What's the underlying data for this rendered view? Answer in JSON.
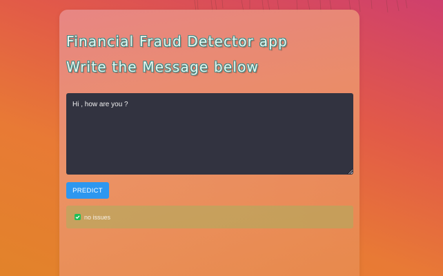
{
  "app": {
    "title": "Financial Fraud Detector app",
    "subtitle": "Write the Message below"
  },
  "message": {
    "value": "Hi , how are you ?",
    "placeholder": ""
  },
  "actions": {
    "predict_label": "PREDICT"
  },
  "result": {
    "text": "no issues",
    "icon": "check-icon",
    "color": "#1fbf56"
  },
  "colors": {
    "accent": "#2d97f0",
    "textarea_bg": "#323340",
    "title_outline": "#3f8a86"
  }
}
